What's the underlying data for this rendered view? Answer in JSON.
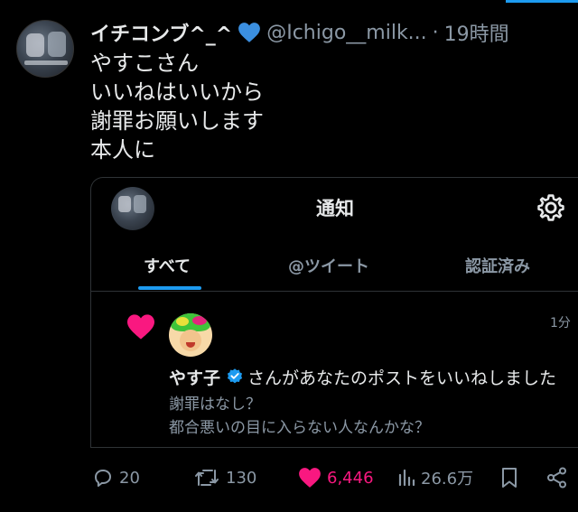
{
  "tweet": {
    "display_name": "イチコンブ^_^",
    "name_emoji": "blue-heart",
    "handle": "@Ichigo__milk...",
    "separator": "·",
    "time": "19時間",
    "lines": [
      "やすこさん",
      "いいねはいいから",
      "謝罪お願いします",
      "本人に"
    ]
  },
  "embedded": {
    "title": "通知",
    "tabs": [
      "すべて",
      "@ツイート",
      "認証済み"
    ],
    "active_tab": "すべて",
    "notification": {
      "time": "1分",
      "username": "やす子",
      "action_text": "さんがあなたのポストをいいねしました",
      "sub_lines": [
        "謝罪はなし？",
        "都合悪いの目に入らない人なんかな？"
      ]
    }
  },
  "actions": {
    "replies": "20",
    "reposts": "130",
    "likes": "6,446",
    "views": "26.6万"
  },
  "colors": {
    "background": "#000000",
    "accent": "#1d9bf0",
    "like": "#f91880",
    "muted": "#8b98a5",
    "text": "#e7e9ea"
  },
  "icons": [
    "reply-icon",
    "repost-icon",
    "like-icon",
    "views-icon",
    "bookmark-icon",
    "share-icon",
    "gear-icon",
    "verified-icon",
    "heart-icon"
  ]
}
